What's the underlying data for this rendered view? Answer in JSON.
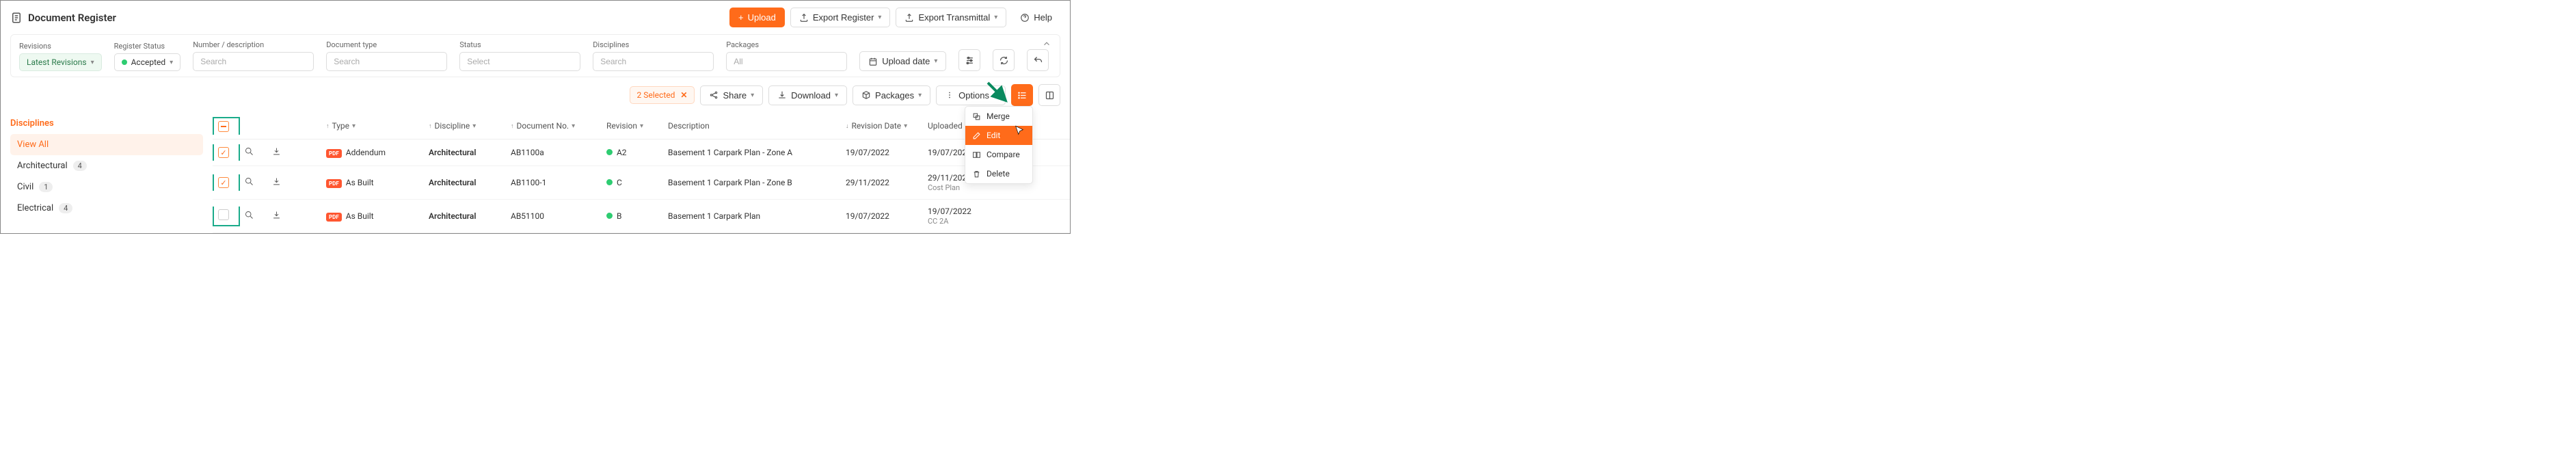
{
  "page": {
    "title": "Document Register"
  },
  "toolbar": {
    "upload": "Upload",
    "export_register": "Export Register",
    "export_transmittal": "Export Transmittal",
    "help": "Help"
  },
  "filters": {
    "revisions": {
      "label": "Revisions",
      "value": "Latest Revisions"
    },
    "register_status": {
      "label": "Register Status",
      "value": "Accepted"
    },
    "number_desc": {
      "label": "Number / description",
      "placeholder": "Search"
    },
    "document_type": {
      "label": "Document type",
      "placeholder": "Search"
    },
    "status": {
      "label": "Status",
      "placeholder": "Select"
    },
    "disciplines": {
      "label": "Disciplines",
      "placeholder": "Search"
    },
    "packages": {
      "label": "Packages",
      "placeholder": "All"
    },
    "upload_date": {
      "label": "Upload date"
    }
  },
  "actions": {
    "selected": "2 Selected",
    "share": "Share",
    "download": "Download",
    "packages": "Packages",
    "options": "Options"
  },
  "options_menu": {
    "merge": "Merge",
    "edit": "Edit",
    "compare": "Compare",
    "delete": "Delete"
  },
  "sidebar": {
    "title": "Disciplines",
    "items": [
      {
        "label": "View All",
        "count": null,
        "active": true
      },
      {
        "label": "Architectural",
        "count": "4",
        "active": false
      },
      {
        "label": "Civil",
        "count": "1",
        "active": false
      },
      {
        "label": "Electrical",
        "count": "4",
        "active": false
      }
    ]
  },
  "columns": {
    "type": "Type",
    "discipline": "Discipline",
    "document_no": "Document No.",
    "revision": "Revision",
    "description": "Description",
    "revision_date": "Revision Date",
    "uploaded_date": "Uploaded Date"
  },
  "rows": [
    {
      "checked": true,
      "filetype": "PDF",
      "type": "Addendum",
      "discipline": "Architectural",
      "docno": "AB1100a",
      "status": "green",
      "revision": "A2",
      "description": "Basement 1 Carpark Plan - Zone A",
      "revdate": "19/07/2022",
      "uploaded": "19/07/2022"
    },
    {
      "checked": true,
      "filetype": "PDF",
      "type": "As Built",
      "discipline": "Architectural",
      "docno": "AB1100-1",
      "status": "green",
      "revision": "C",
      "description": "Basement 1 Carpark Plan - Zone B",
      "revdate": "29/11/2022",
      "uploaded": "29/11/2022",
      "trailing": "Cost Plan"
    },
    {
      "checked": false,
      "filetype": "PDF",
      "type": "As Built",
      "discipline": "Architectural",
      "docno": "AB51100",
      "status": "green",
      "revision": "B",
      "description": "Basement 1 Carpark Plan",
      "revdate": "19/07/2022",
      "uploaded": "19/07/2022",
      "trailing": "CC 2A"
    }
  ]
}
